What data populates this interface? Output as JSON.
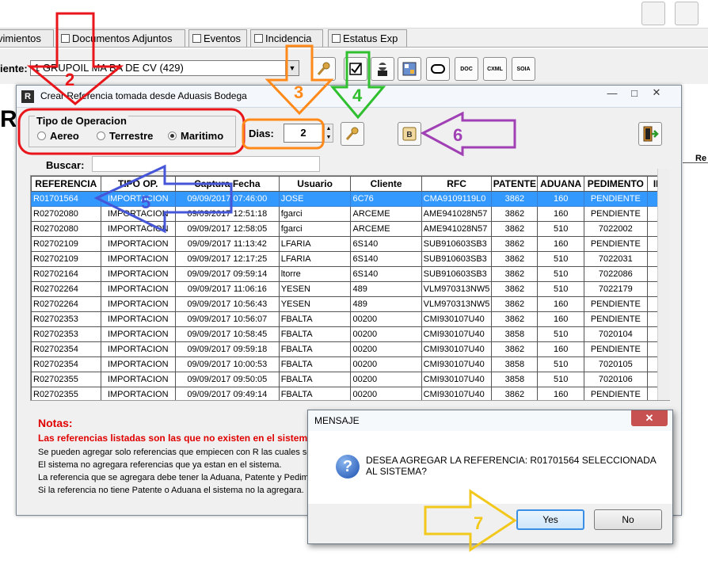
{
  "background": {
    "tabs": [
      {
        "label": "vimientos"
      },
      {
        "label": "Documentos Adjuntos"
      },
      {
        "label": "Eventos"
      },
      {
        "label": "Incidencia"
      },
      {
        "label": "Estatus Exp"
      }
    ],
    "client_label": "iente:",
    "client_value": "1  GRUPOIL MA  BA DE CV (429)",
    "toolbar_labels": {
      "doc": "DOC",
      "cxml": "CXML",
      "soia": "SOIA"
    },
    "right_cut_label": "Re"
  },
  "dialog": {
    "title": "Crear Referencia tomada desde Aduasis Bodega",
    "tipo_operacion_label": "Tipo de Operacion",
    "options": [
      {
        "label": "Aereo",
        "selected": false
      },
      {
        "label": "Terrestre",
        "selected": false
      },
      {
        "label": "Maritimo",
        "selected": true
      }
    ],
    "dias_label": "Dias:",
    "dias_value": "2",
    "b_button_label": "B",
    "buscar_label": "Buscar:",
    "buscar_value": "",
    "columns": [
      "REFERENCIA",
      "TIPO OP.",
      "Captura Fecha",
      "Usuario",
      "Cliente",
      "RFC",
      "PATENTE",
      "ADUANA",
      "PEDIMENTO",
      "ID"
    ],
    "rows": [
      [
        "R01701564",
        "IMPORTACION",
        "09/09/2017 07:46:00",
        "JOSE",
        "6C76",
        "CMA9109119L0",
        "3862",
        "160",
        "PENDIENTE"
      ],
      [
        "R02702080",
        "IMPORTACION",
        "09/09/2017 12:51:18",
        "fgarci",
        "ARCEME",
        "AME941028N57",
        "3862",
        "160",
        "PENDIENTE"
      ],
      [
        "R02702080",
        "IMPORTACION",
        "09/09/2017 12:58:05",
        "fgarci",
        "ARCEME",
        "AME941028N57",
        "3862",
        "510",
        "7022002"
      ],
      [
        "R02702109",
        "IMPORTACION",
        "09/09/2017 11:13:42",
        "LFARIA",
        "6S140",
        "SUB910603SB3",
        "3862",
        "160",
        "PENDIENTE"
      ],
      [
        "R02702109",
        "IMPORTACION",
        "09/09/2017 12:17:25",
        "LFARIA",
        "6S140",
        "SUB910603SB3",
        "3862",
        "510",
        "7022031"
      ],
      [
        "R02702164",
        "IMPORTACION",
        "09/09/2017 09:59:14",
        "ltorre",
        "6S140",
        "SUB910603SB3",
        "3862",
        "510",
        "7022086"
      ],
      [
        "R02702264",
        "IMPORTACION",
        "09/09/2017 11:06:16",
        "YESEN",
        "489",
        "VLM970313NW5",
        "3862",
        "510",
        "7022179"
      ],
      [
        "R02702264",
        "IMPORTACION",
        "09/09/2017 10:56:43",
        "YESEN",
        "489",
        "VLM970313NW5",
        "3862",
        "160",
        "PENDIENTE"
      ],
      [
        "R02702353",
        "IMPORTACION",
        "09/09/2017 10:56:07",
        "FBALTA",
        "00200",
        "CMI930107U40",
        "3862",
        "160",
        "PENDIENTE"
      ],
      [
        "R02702353",
        "IMPORTACION",
        "09/09/2017 10:58:45",
        "FBALTA",
        "00200",
        "CMI930107U40",
        "3858",
        "510",
        "7020104"
      ],
      [
        "R02702354",
        "IMPORTACION",
        "09/09/2017 09:59:18",
        "FBALTA",
        "00200",
        "CMI930107U40",
        "3862",
        "160",
        "PENDIENTE"
      ],
      [
        "R02702354",
        "IMPORTACION",
        "09/09/2017 10:00:53",
        "FBALTA",
        "00200",
        "CMI930107U40",
        "3858",
        "510",
        "7020105"
      ],
      [
        "R02702355",
        "IMPORTACION",
        "09/09/2017 09:50:05",
        "FBALTA",
        "00200",
        "CMI930107U40",
        "3858",
        "510",
        "7020106"
      ],
      [
        "R02702355",
        "IMPORTACION",
        "09/09/2017 09:49:14",
        "FBALTA",
        "00200",
        "CMI930107U40",
        "3862",
        "160",
        "PENDIENTE"
      ]
    ],
    "selected_row": 0,
    "notas_title": "Notas:",
    "notas_red": "Las referencias listadas son las que no existen en el sistema",
    "notas_lines": [
      "Se pueden agregar solo referencias que empiecen con R las cuales son",
      "El sistema no agregara referencias que ya estan en el sistema.",
      "La referencia que se agregara debe tener la Aduana, Patente y Pedime",
      "Si la referencia no tiene Patente o Aduana el sistema no la agregara."
    ]
  },
  "message": {
    "title": "MENSAJE",
    "text": "DESEA AGREGAR LA REFERENCIA: R01701564 SELECCIONADA AL SISTEMA?",
    "yes_label": "Yes",
    "no_label": "No"
  },
  "annotations": {
    "numbers": [
      "2",
      "3",
      "4",
      "5",
      "6",
      "7"
    ],
    "colors": {
      "red": "#e8161b",
      "orange": "#ff8a1a",
      "green": "#2fbf2f",
      "blue": "#4656d8",
      "purple": "#a040b4",
      "yellow": "#f2c81c"
    }
  },
  "colors": {
    "selection": "#3399ff",
    "note_red": "#e00000",
    "close_red": "#c75050"
  }
}
